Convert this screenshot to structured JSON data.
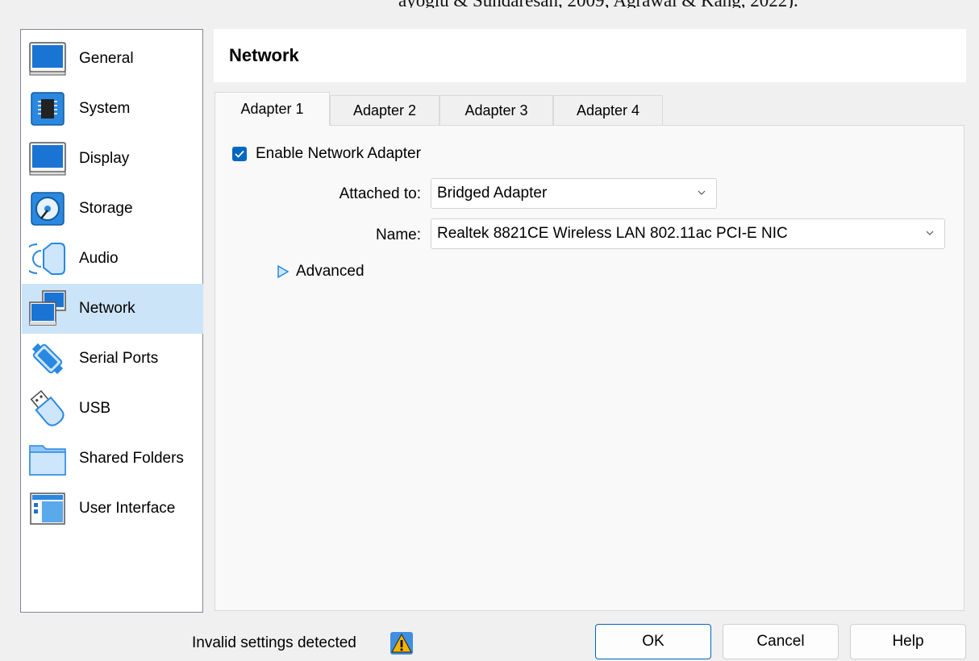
{
  "background_text": "ayoglu & Sundaresan, 2009; Agrawal & Kang, 2022).",
  "sidebar": {
    "items": [
      {
        "label": "General",
        "icon": "general-monitor-icon"
      },
      {
        "label": "System",
        "icon": "system-chip-icon"
      },
      {
        "label": "Display",
        "icon": "display-monitor-icon"
      },
      {
        "label": "Storage",
        "icon": "storage-disk-icon"
      },
      {
        "label": "Audio",
        "icon": "audio-speaker-icon"
      },
      {
        "label": "Network",
        "icon": "network-monitors-icon",
        "selected": true
      },
      {
        "label": "Serial Ports",
        "icon": "serial-port-icon"
      },
      {
        "label": "USB",
        "icon": "usb-plug-icon"
      },
      {
        "label": "Shared Folders",
        "icon": "folder-icon"
      },
      {
        "label": "User Interface",
        "icon": "user-interface-icon"
      }
    ]
  },
  "header": {
    "title": "Network"
  },
  "tabs": [
    {
      "label": "Adapter 1",
      "active": true
    },
    {
      "label": "Adapter 2"
    },
    {
      "label": "Adapter 3"
    },
    {
      "label": "Adapter 4"
    }
  ],
  "adapter": {
    "enable_label": "Enable Network Adapter",
    "enabled": true,
    "attached_label": "Attached to:",
    "attached_value": "Bridged Adapter",
    "name_label": "Name:",
    "name_value": "Realtek 8821CE Wireless LAN 802.11ac PCI-E NIC",
    "advanced_label": "Advanced"
  },
  "footer": {
    "status": "Invalid settings detected",
    "ok_label": "OK",
    "cancel_label": "Cancel",
    "help_label": "Help"
  },
  "colors": {
    "accent": "#0067c0",
    "selected_bg": "#cce4f7",
    "icon_blue": "#1e7fd6"
  }
}
